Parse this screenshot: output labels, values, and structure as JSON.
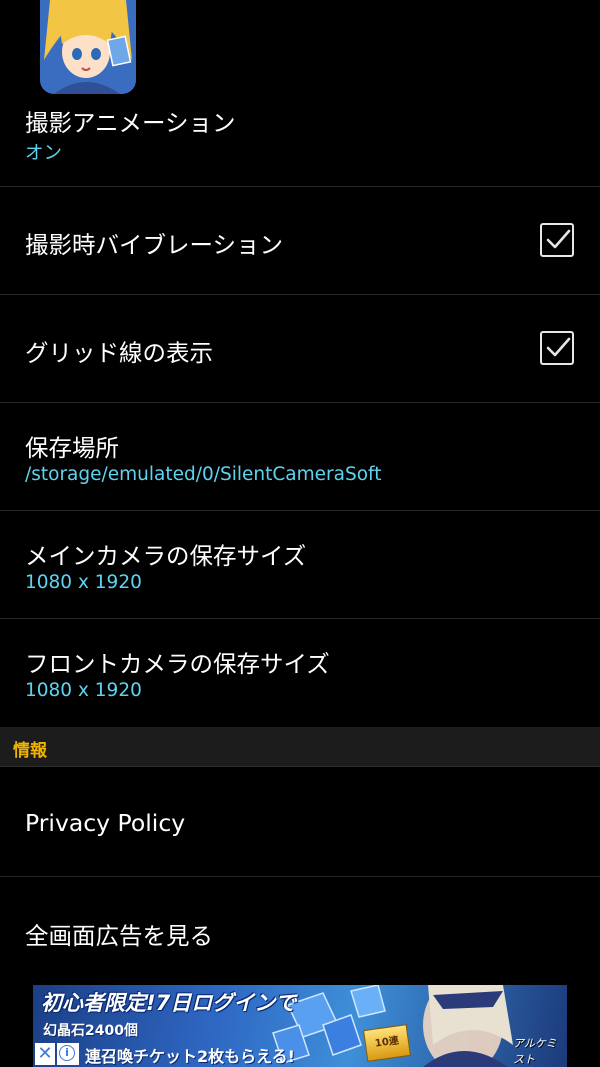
{
  "settings": {
    "shoot_animation": {
      "title": "撮影アニメーション",
      "value": "オン"
    },
    "shoot_vibration": {
      "title": "撮影時バイブレーション",
      "checked": true
    },
    "grid_lines": {
      "title": "グリッド線の表示",
      "checked": true
    },
    "save_location": {
      "title": "保存場所",
      "value": "/storage/emulated/0/SilentCameraSoft"
    },
    "main_camera_size": {
      "title": "メインカメラの保存サイズ",
      "value": "1080 x 1920"
    },
    "front_camera_size": {
      "title": "フロントカメラの保存サイズ",
      "value": "1080 x 1920"
    }
  },
  "info_section": {
    "header": "情報",
    "privacy_policy": "Privacy Policy",
    "fullscreen_ad": "全画面広告を見る"
  },
  "ad_banner": {
    "line1": "初心者限定!7日ログインで",
    "line2": "幻晶石2400個",
    "line3": "連召喚チケット2枚もらえる!",
    "close_glyph": "✕",
    "info_glyph": "i",
    "ticket_text": "10連",
    "logo_text": "アルケミスト"
  },
  "colors": {
    "background": "#000000",
    "accent_value": "#5ed3f0",
    "section_header": "#f0b400"
  }
}
